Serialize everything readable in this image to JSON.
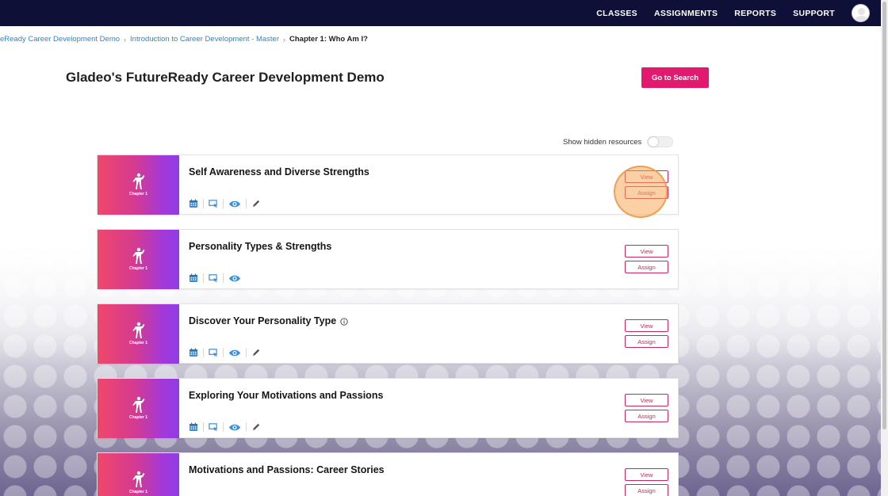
{
  "nav": {
    "items": [
      "CLASSES",
      "ASSIGNMENTS",
      "REPORTS",
      "SUPPORT"
    ]
  },
  "breadcrumb": {
    "items": [
      "eReady Career Development Demo",
      "Introduction to Career Development - Master"
    ],
    "current": "Chapter 1: Who Am I?"
  },
  "page": {
    "title": "Gladeo's FutureReady Career Development Demo",
    "search_button": "Go to Search",
    "show_hidden_label": "Show hidden resources",
    "show_hidden_on": false
  },
  "thumb_caption": "Chapter 1",
  "buttons": {
    "view": "View",
    "assign": "Assign"
  },
  "colors": {
    "topbar": "#0f1038",
    "accent": "#e3196f",
    "link": "#2f86c9",
    "icon": "#3a8fd6"
  },
  "cards": [
    {
      "title": "Self Awareness and Diverse Strengths",
      "info": false,
      "icons": [
        "calendar-icon",
        "present-icon",
        "eye-icon",
        "pencil-icon"
      ]
    },
    {
      "title": "Personality Types & Strengths",
      "info": false,
      "icons": [
        "calendar-icon",
        "present-icon",
        "eye-icon"
      ]
    },
    {
      "title": "Discover Your Personality Type",
      "info": true,
      "icons": [
        "calendar-icon",
        "present-icon",
        "eye-icon",
        "pencil-icon"
      ]
    },
    {
      "title": "Exploring Your Motivations and Passions",
      "info": false,
      "icons": [
        "calendar-icon",
        "present-icon",
        "eye-icon",
        "pencil-icon"
      ]
    },
    {
      "title": "Motivations and Passions: Career Stories",
      "info": false,
      "icons": []
    }
  ]
}
